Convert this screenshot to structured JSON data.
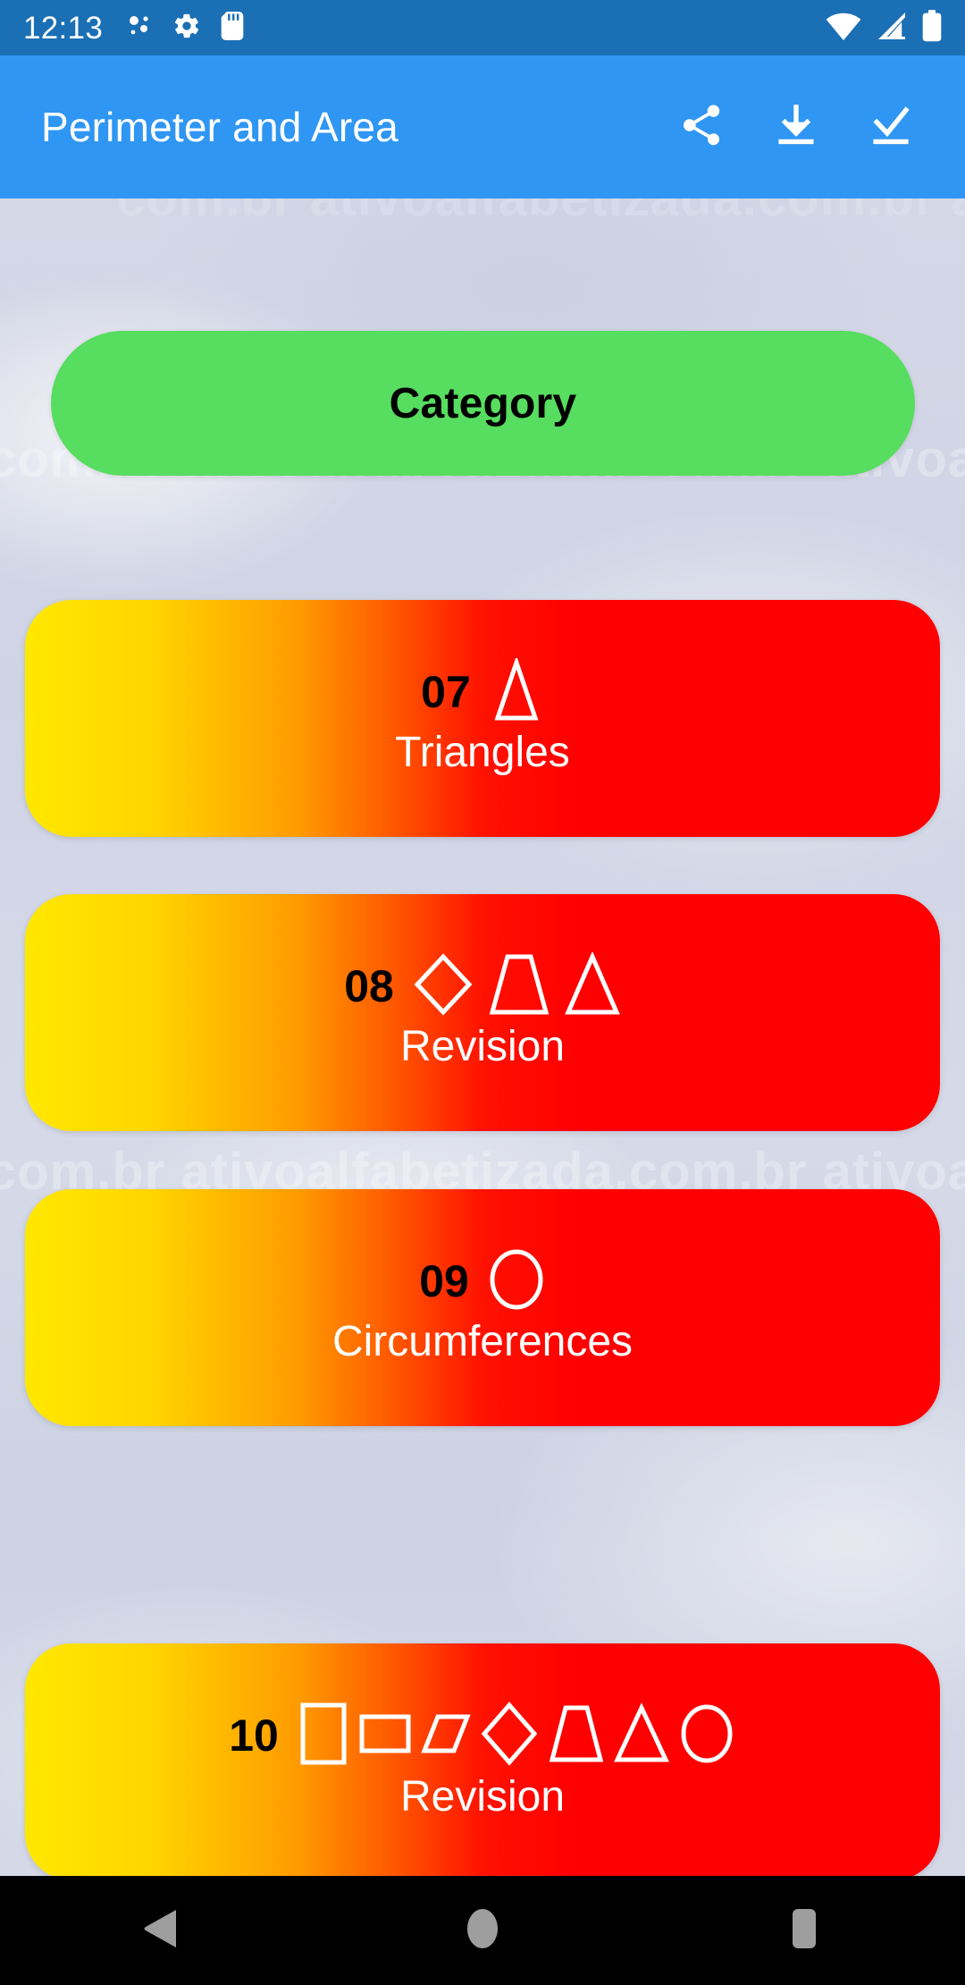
{
  "statusbar": {
    "clock": "12:13",
    "left_icons": [
      "bluetooth-transfer-icon",
      "gear-icon",
      "sd-card-icon"
    ],
    "right_icons": [
      "wifi-icon",
      "cell-signal-icon",
      "battery-icon"
    ],
    "background_color": "#1A6FB5"
  },
  "appbar": {
    "title": "Perimeter and Area",
    "background_color": "#2F96F3",
    "actions": [
      {
        "name": "share-button",
        "icon": "share-icon"
      },
      {
        "name": "download-button",
        "icon": "download-icon"
      },
      {
        "name": "confirm-button",
        "icon": "check-icon"
      }
    ]
  },
  "content": {
    "background_watermark": "com.br   ativoalfabetizada.com.br   ativoa",
    "category_button": {
      "label": "Category",
      "color": "#57DD5F",
      "text_color": "#000000"
    },
    "cards": [
      {
        "number": "07",
        "label": "Triangles",
        "shapes": [
          "triangle"
        ]
      },
      {
        "number": "08",
        "label": "Revision",
        "shapes": [
          "rhombus",
          "trapezoid",
          "triangle"
        ]
      },
      {
        "number": "09",
        "label": "Circumferences",
        "shapes": [
          "circle"
        ]
      },
      {
        "number": "10",
        "label": "Revision",
        "shapes": [
          "square",
          "rectangle",
          "parallelogram",
          "rhombus",
          "trapezoid",
          "triangle",
          "circle"
        ]
      }
    ],
    "card_gradient_start": "#FFE800",
    "card_gradient_end": "#FF0000",
    "card_number_color": "#000000",
    "card_label_color": "#FFFFFF"
  },
  "navbar": {
    "background_color": "#000000",
    "buttons": [
      {
        "name": "back-button",
        "icon": "triangle-back-icon"
      },
      {
        "name": "home-button",
        "icon": "circle-home-icon"
      },
      {
        "name": "recents-button",
        "icon": "square-recents-icon"
      }
    ]
  }
}
